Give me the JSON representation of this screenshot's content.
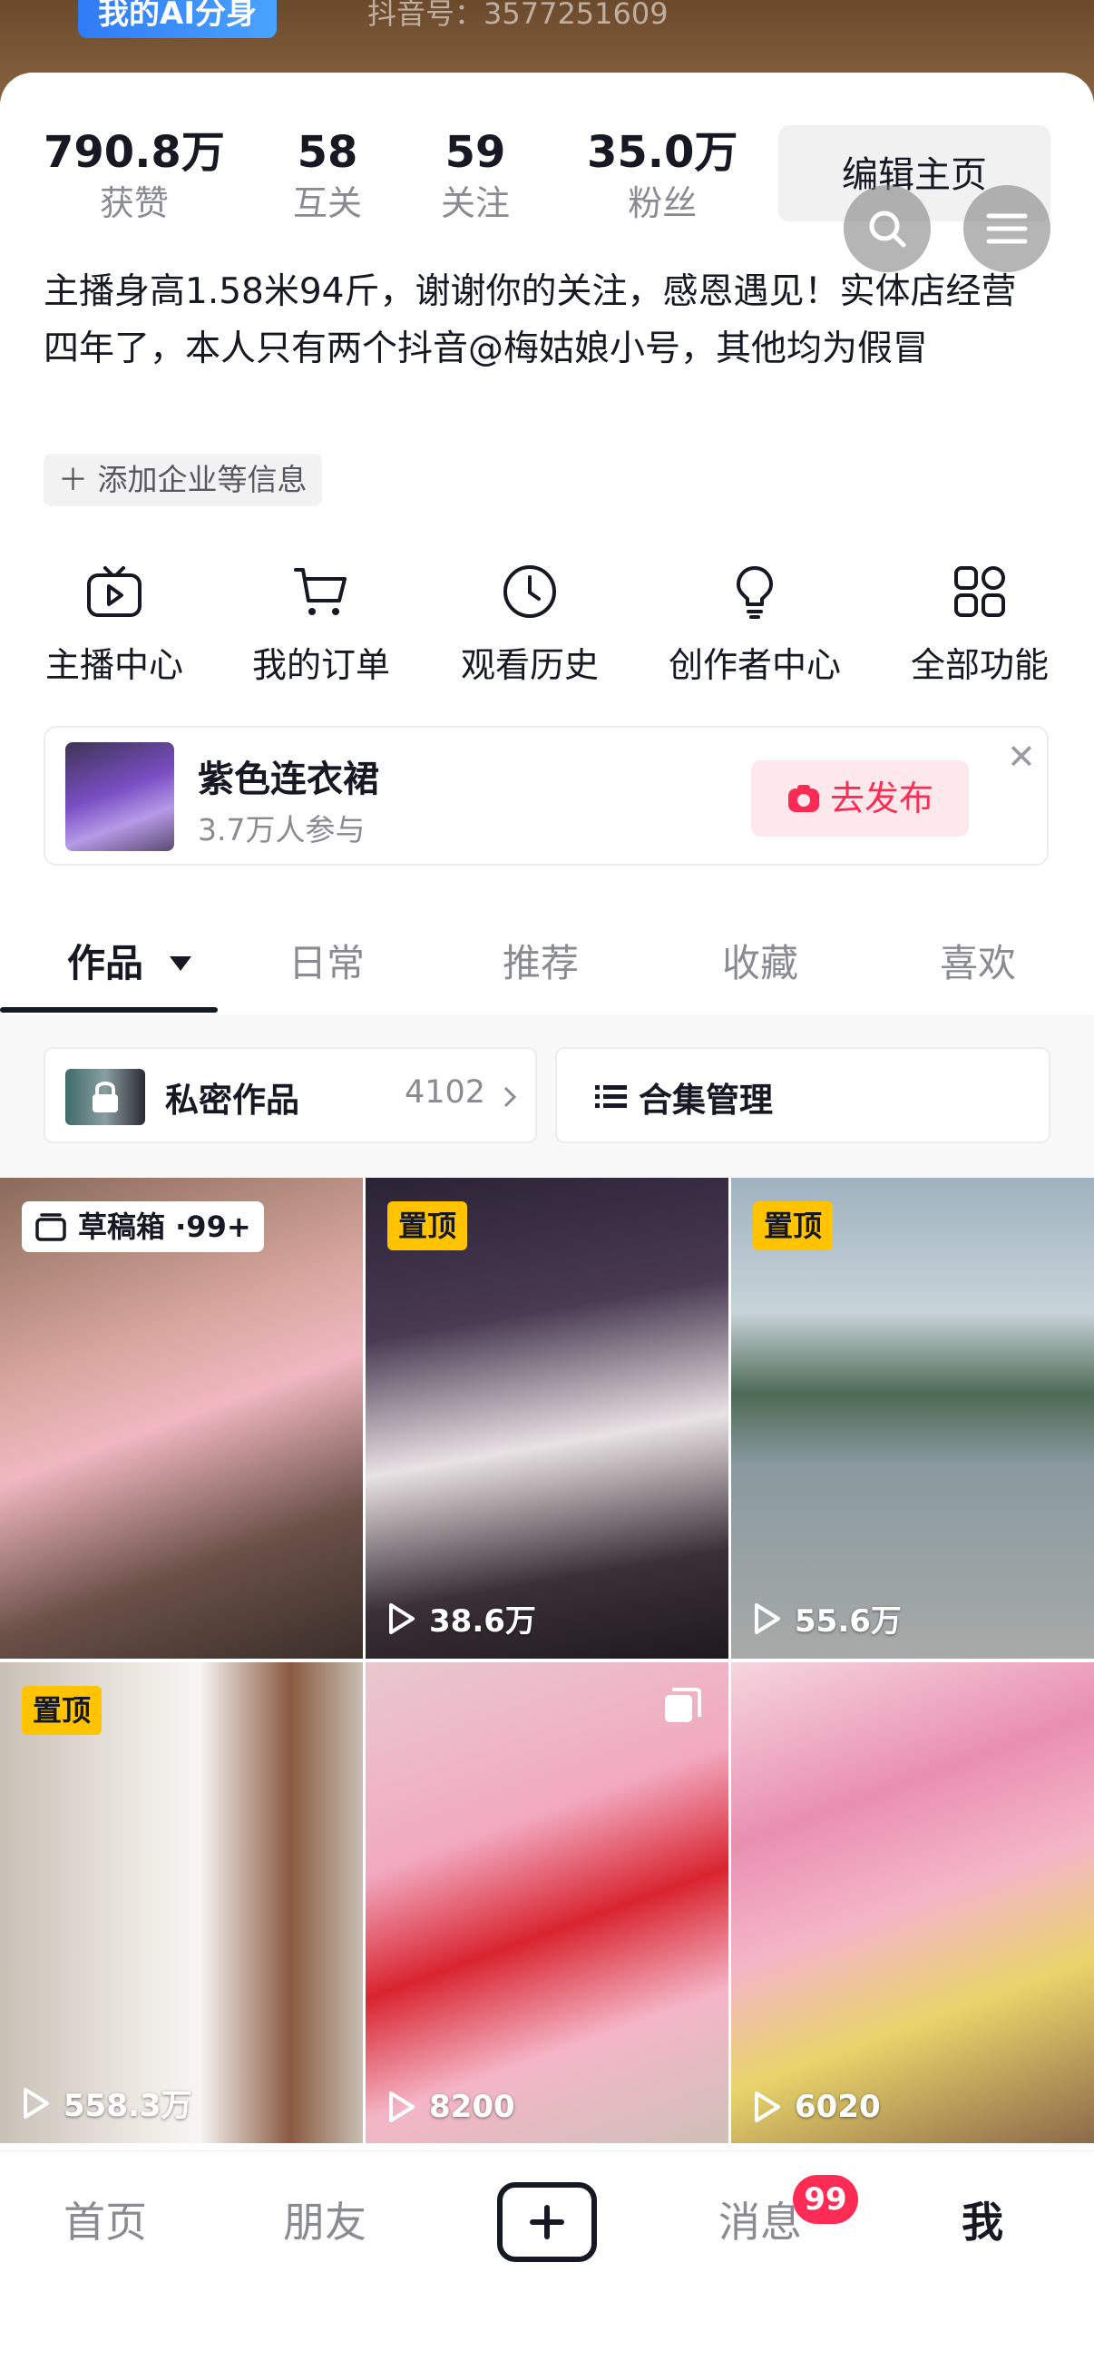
{
  "header": {
    "ai_badge": "我的AI分身",
    "douyin_id": "抖音号：3577251609"
  },
  "stats": [
    {
      "value": "790.8万",
      "label": "获赞"
    },
    {
      "value": "58",
      "label": "互关"
    },
    {
      "value": "59",
      "label": "关注"
    },
    {
      "value": "35.0万",
      "label": "粉丝"
    }
  ],
  "edit_profile": "编辑主页",
  "bio": "主播身高1.58米94斤，谢谢你的关注，感恩遇见！实体店经营四年了，本人只有两个抖音@梅姑娘小号，其他均为假冒",
  "add_info": "添加企业等信息",
  "actions": [
    {
      "label": "主播中心",
      "icon": "tv-icon"
    },
    {
      "label": "我的订单",
      "icon": "cart-icon"
    },
    {
      "label": "观看历史",
      "icon": "clock-icon"
    },
    {
      "label": "创作者中心",
      "icon": "lightbulb-icon"
    },
    {
      "label": "全部功能",
      "icon": "grid-icon"
    }
  ],
  "topic": {
    "title": "紫色连衣裙",
    "participants": "3.7万人参与",
    "publish": "去发布"
  },
  "tabs": [
    "作品",
    "日常",
    "推荐",
    "收藏",
    "喜欢"
  ],
  "private_works": {
    "label": "私密作品",
    "count": "4102"
  },
  "collection": {
    "label": "合集管理"
  },
  "grid": [
    {
      "badge": "草稿箱 ·99+",
      "plays": ""
    },
    {
      "badge": "置顶",
      "plays": "38.6万"
    },
    {
      "badge": "置顶",
      "plays": "55.6万"
    },
    {
      "badge": "置顶",
      "plays": "558.3万"
    },
    {
      "badge": "",
      "plays": "8200"
    },
    {
      "badge": "",
      "plays": "6020"
    }
  ],
  "nav": {
    "home": "首页",
    "friends": "朋友",
    "messages": "消息",
    "messages_badge": "99",
    "me": "我"
  },
  "colors": {
    "accent": "#fe2c55",
    "pin": "#ffc300"
  }
}
